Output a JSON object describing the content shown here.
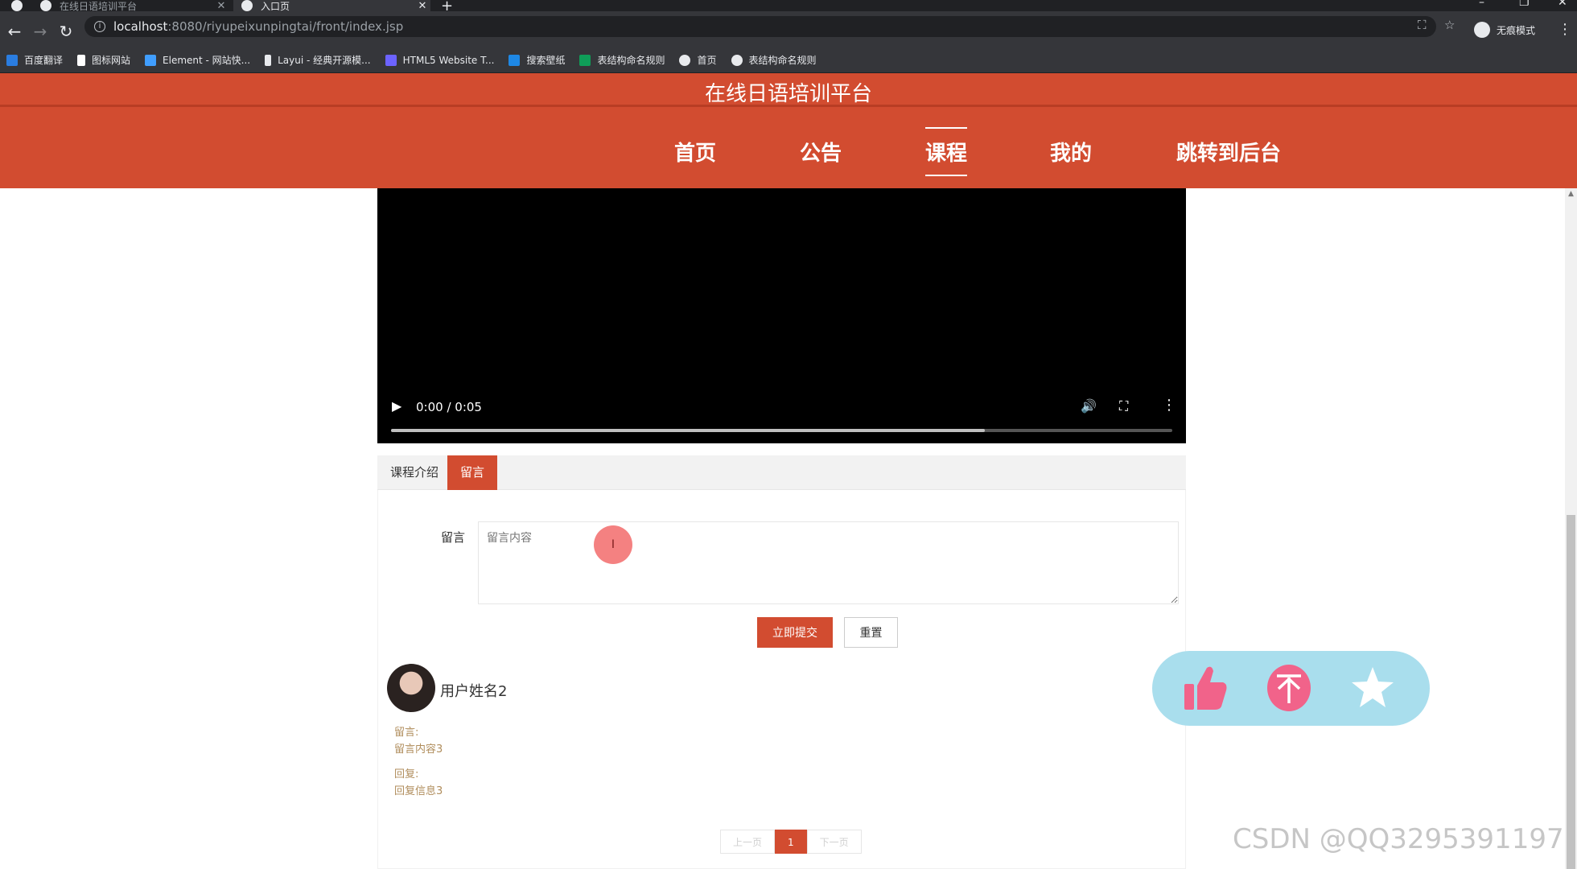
{
  "browser": {
    "tabs": [
      {
        "title": "在线日语培训平台"
      },
      {
        "title": "入口页"
      }
    ],
    "new_tab": "+",
    "url_host": "localhost",
    "url_path": ":8080/riyupeixunpingtai/front/index.jsp",
    "profile_label": "无痕模式",
    "bookmarks": [
      {
        "label": "百度翻译",
        "color": "#2a7de1"
      },
      {
        "label": "图标网站",
        "color": "#ffffff"
      },
      {
        "label": "Element - 网站快...",
        "color": "#409eff"
      },
      {
        "label": "Layui - 经典开源模...",
        "color": "#e8eaed"
      },
      {
        "label": "HTML5 Website T...",
        "color": "#6c63ff"
      },
      {
        "label": "搜索壁纸",
        "color": "#1e88e5"
      },
      {
        "label": "表结构命名规则",
        "color": "#0f9d58"
      },
      {
        "label": "首页",
        "color": "#e8eaed"
      },
      {
        "label": "表结构命名规则",
        "color": "#e8eaed"
      }
    ]
  },
  "site": {
    "title": "在线日语培训平台",
    "brand_color": "#d24c30",
    "nav": [
      {
        "label": "首页",
        "active": false
      },
      {
        "label": "公告",
        "active": false
      },
      {
        "label": "课程",
        "active": true
      },
      {
        "label": "我的",
        "active": false
      },
      {
        "label": "跳转到后台",
        "active": false
      }
    ]
  },
  "video": {
    "time": "0:00 / 0:05",
    "progress": 0.76
  },
  "detail_tabs": [
    {
      "label": "课程介绍",
      "active": false
    },
    {
      "label": "留言",
      "active": true
    }
  ],
  "comment_form": {
    "label": "留言",
    "placeholder": "留言内容",
    "submit_label": "立即提交",
    "reset_label": "重置"
  },
  "comments": [
    {
      "user": "用户姓名2",
      "comment_label": "留言:",
      "comment_text": "留言内容3",
      "reply_label": "回复:",
      "reply_text": "回复信息3"
    }
  ],
  "pagination": {
    "prev": "上一页",
    "current": "1",
    "next": "下一页"
  },
  "watermark": "CSDN @QQ3295391197"
}
